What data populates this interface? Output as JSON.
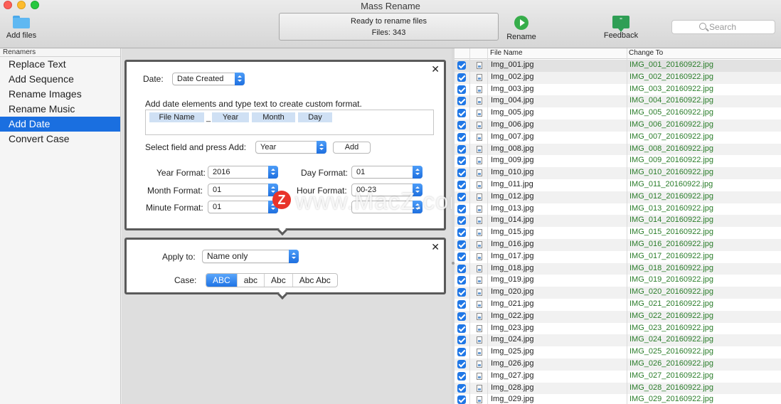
{
  "window": {
    "title": "Mass Rename"
  },
  "toolbar": {
    "add_files": "Add files",
    "status_line1": "Ready to rename files",
    "status_line2": "Files: 343",
    "rename": "Rename",
    "feedback": "Feedback",
    "search_placeholder": "Search"
  },
  "sidebar": {
    "header": "Renamers",
    "items": [
      {
        "label": "Replace Text"
      },
      {
        "label": "Add Sequence"
      },
      {
        "label": "Rename Images"
      },
      {
        "label": "Rename Music"
      },
      {
        "label": "Add Date",
        "selected": true
      },
      {
        "label": "Convert Case"
      }
    ]
  },
  "date_panel": {
    "date_label": "Date:",
    "date_value": "Date Created",
    "instruction": "Add date elements and type text to create custom format.",
    "tokens": [
      "File Name",
      "_",
      "Year",
      "Month",
      "Day"
    ],
    "select_label": "Select field and press Add:",
    "select_value": "Year",
    "add_button": "Add",
    "year_format_label": "Year Format:",
    "year_format_value": "2016",
    "day_format_label": "Day Format:",
    "day_format_value": "01",
    "month_format_label": "Month Format:",
    "month_format_value": "01",
    "hour_format_label": "Hour Format:",
    "hour_format_value": "00-23",
    "minute_format_label": "Minute Format:",
    "minute_format_value": "01"
  },
  "case_panel": {
    "apply_label": "Apply to:",
    "apply_value": "Name only",
    "case_label": "Case:",
    "options": [
      "ABC",
      "abc",
      "Abc",
      "Abc Abc"
    ],
    "selected": "ABC"
  },
  "watermark": {
    "logo": "Z",
    "text": "www.MacZ.com"
  },
  "table": {
    "headers": {
      "file_name": "File Name",
      "change_to": "Change To"
    },
    "rows": [
      {
        "name": "Img_001.jpg",
        "new": "IMG_001_20160922.jpg"
      },
      {
        "name": "Img_002.jpg",
        "new": "IMG_002_20160922.jpg"
      },
      {
        "name": "Img_003.jpg",
        "new": "IMG_003_20160922.jpg"
      },
      {
        "name": "Img_004.jpg",
        "new": "IMG_004_20160922.jpg"
      },
      {
        "name": "Img_005.jpg",
        "new": "IMG_005_20160922.jpg"
      },
      {
        "name": "Img_006.jpg",
        "new": "IMG_006_20160922.jpg"
      },
      {
        "name": "Img_007.jpg",
        "new": "IMG_007_20160922.jpg"
      },
      {
        "name": "Img_008.jpg",
        "new": "IMG_008_20160922.jpg"
      },
      {
        "name": "Img_009.jpg",
        "new": "IMG_009_20160922.jpg"
      },
      {
        "name": "Img_010.jpg",
        "new": "IMG_010_20160922.jpg"
      },
      {
        "name": "Img_011.jpg",
        "new": "IMG_011_20160922.jpg"
      },
      {
        "name": "Img_012.jpg",
        "new": "IMG_012_20160922.jpg"
      },
      {
        "name": "Img_013.jpg",
        "new": "IMG_013_20160922.jpg"
      },
      {
        "name": "Img_014.jpg",
        "new": "IMG_014_20160922.jpg"
      },
      {
        "name": "Img_015.jpg",
        "new": "IMG_015_20160922.jpg"
      },
      {
        "name": "Img_016.jpg",
        "new": "IMG_016_20160922.jpg"
      },
      {
        "name": "Img_017.jpg",
        "new": "IMG_017_20160922.jpg"
      },
      {
        "name": "Img_018.jpg",
        "new": "IMG_018_20160922.jpg"
      },
      {
        "name": "Img_019.jpg",
        "new": "IMG_019_20160922.jpg"
      },
      {
        "name": "Img_020.jpg",
        "new": "IMG_020_20160922.jpg"
      },
      {
        "name": "Img_021.jpg",
        "new": "IMG_021_20160922.jpg"
      },
      {
        "name": "Img_022.jpg",
        "new": "IMG_022_20160922.jpg"
      },
      {
        "name": "Img_023.jpg",
        "new": "IMG_023_20160922.jpg"
      },
      {
        "name": "Img_024.jpg",
        "new": "IMG_024_20160922.jpg"
      },
      {
        "name": "Img_025.jpg",
        "new": "IMG_025_20160922.jpg"
      },
      {
        "name": "Img_026.jpg",
        "new": "IMG_026_20160922.jpg"
      },
      {
        "name": "Img_027.jpg",
        "new": "IMG_027_20160922.jpg"
      },
      {
        "name": "Img_028.jpg",
        "new": "IMG_028_20160922.jpg"
      },
      {
        "name": "Img_029.jpg",
        "new": "IMG_029_20160922.jpg"
      }
    ]
  }
}
